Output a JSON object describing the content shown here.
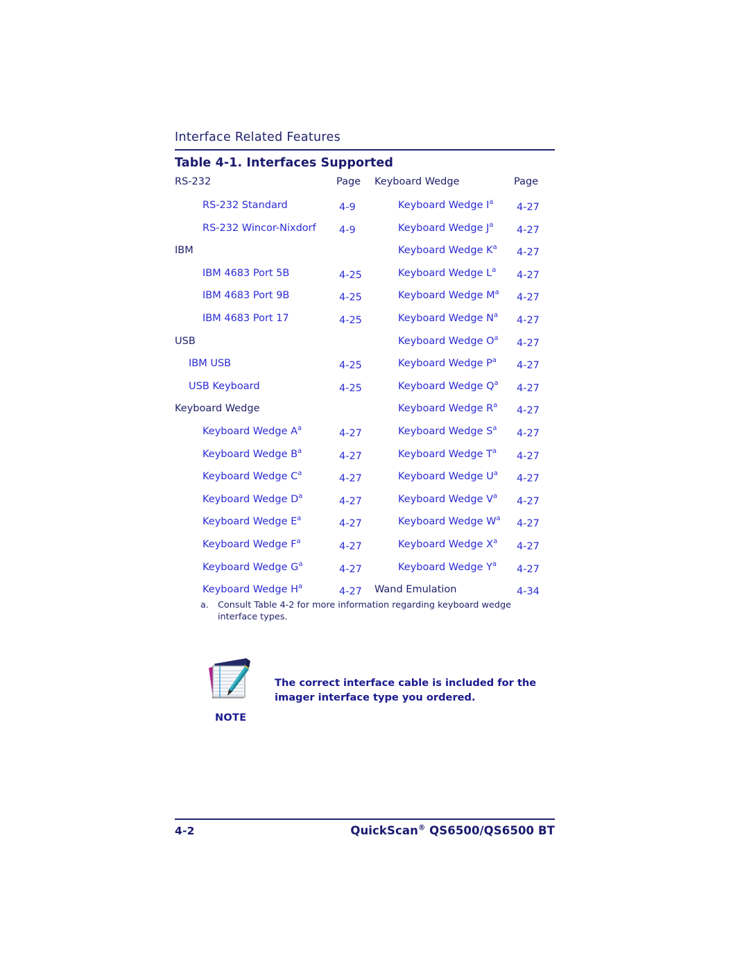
{
  "header": {
    "running_head": "Interface Related Features",
    "table_caption": "Table 4-1. Interfaces Supported"
  },
  "colors": {
    "navy": "#20206b",
    "link_blue": "#2b2bd6",
    "note_blue": "#1a1a8e",
    "page_background": "#ffffff"
  },
  "table": {
    "left_column_header": "RS-232",
    "left_page_header": "Page",
    "right_column_header": "Keyboard Wedge",
    "right_page_header": "Page",
    "left_rows": [
      {
        "label": "RS-232 Standard",
        "page": "4-9",
        "kind": "link",
        "indent": 2,
        "footnote": false
      },
      {
        "label": "RS-232 Wincor-Nixdorf",
        "page": "4-9",
        "kind": "link",
        "indent": 2,
        "footnote": false
      },
      {
        "label": "IBM",
        "page": "",
        "kind": "group",
        "indent": 0,
        "footnote": false
      },
      {
        "label": "IBM 4683 Port 5B",
        "page": "4-25",
        "kind": "link",
        "indent": 2,
        "footnote": false
      },
      {
        "label": "IBM 4683 Port 9B",
        "page": "4-25",
        "kind": "link",
        "indent": 2,
        "footnote": false
      },
      {
        "label": "IBM 4683 Port 17",
        "page": "4-25",
        "kind": "link",
        "indent": 2,
        "footnote": false
      },
      {
        "label": "USB",
        "page": "",
        "kind": "group",
        "indent": 0,
        "footnote": false
      },
      {
        "label": "IBM USB",
        "page": "4-25",
        "kind": "link",
        "indent": 1,
        "footnote": false
      },
      {
        "label": "USB Keyboard",
        "page": "4-25",
        "kind": "link",
        "indent": 1,
        "footnote": false
      },
      {
        "label": "Keyboard Wedge",
        "page": "",
        "kind": "group",
        "indent": 0,
        "footnote": false
      },
      {
        "label": "Keyboard Wedge A",
        "page": "4-27",
        "kind": "link",
        "indent": 2,
        "footnote": true
      },
      {
        "label": "Keyboard Wedge B",
        "page": "4-27",
        "kind": "link",
        "indent": 2,
        "footnote": true
      },
      {
        "label": "Keyboard Wedge C",
        "page": "4-27",
        "kind": "link",
        "indent": 2,
        "footnote": true
      },
      {
        "label": "Keyboard Wedge D",
        "page": "4-27",
        "kind": "link",
        "indent": 2,
        "footnote": true
      },
      {
        "label": "Keyboard Wedge E",
        "page": "4-27",
        "kind": "link",
        "indent": 2,
        "footnote": true
      },
      {
        "label": "Keyboard Wedge F",
        "page": "4-27",
        "kind": "link",
        "indent": 2,
        "footnote": true
      },
      {
        "label": "Keyboard Wedge G",
        "page": "4-27",
        "kind": "link",
        "indent": 2,
        "footnote": true
      },
      {
        "label": "Keyboard Wedge H",
        "page": "4-27",
        "kind": "link",
        "indent": 2,
        "footnote": true
      }
    ],
    "right_rows": [
      {
        "label": "Keyboard Wedge I",
        "page": "4-27",
        "kind": "link",
        "indent": 1,
        "footnote": true
      },
      {
        "label": "Keyboard Wedge J",
        "page": "4-27",
        "kind": "link",
        "indent": 1,
        "footnote": true
      },
      {
        "label": "Keyboard Wedge K",
        "page": "4-27",
        "kind": "link",
        "indent": 1,
        "footnote": true
      },
      {
        "label": "Keyboard Wedge L",
        "page": "4-27",
        "kind": "link",
        "indent": 1,
        "footnote": true
      },
      {
        "label": "Keyboard Wedge M",
        "page": "4-27",
        "kind": "link",
        "indent": 1,
        "footnote": true
      },
      {
        "label": "Keyboard Wedge N",
        "page": "4-27",
        "kind": "link",
        "indent": 1,
        "footnote": true
      },
      {
        "label": "Keyboard Wedge O",
        "page": "4-27",
        "kind": "link",
        "indent": 1,
        "footnote": true
      },
      {
        "label": "Keyboard Wedge P",
        "page": "4-27",
        "kind": "link",
        "indent": 1,
        "footnote": true
      },
      {
        "label": "Keyboard Wedge Q",
        "page": "4-27",
        "kind": "link",
        "indent": 1,
        "footnote": true
      },
      {
        "label": "Keyboard Wedge R",
        "page": "4-27",
        "kind": "link",
        "indent": 1,
        "footnote": true
      },
      {
        "label": "Keyboard Wedge S",
        "page": "4-27",
        "kind": "link",
        "indent": 1,
        "footnote": true
      },
      {
        "label": "Keyboard Wedge T",
        "page": "4-27",
        "kind": "link",
        "indent": 1,
        "footnote": true
      },
      {
        "label": "Keyboard Wedge U",
        "page": "4-27",
        "kind": "link",
        "indent": 1,
        "footnote": true
      },
      {
        "label": "Keyboard Wedge V",
        "page": "4-27",
        "kind": "link",
        "indent": 1,
        "footnote": true
      },
      {
        "label": "Keyboard Wedge W",
        "page": "4-27",
        "kind": "link",
        "indent": 1,
        "footnote": true
      },
      {
        "label": "Keyboard Wedge X",
        "page": "4-27",
        "kind": "link",
        "indent": 1,
        "footnote": true
      },
      {
        "label": "Keyboard Wedge Y",
        "page": "4-27",
        "kind": "link",
        "indent": 1,
        "footnote": true
      },
      {
        "label": "Wand Emulation",
        "page": "4-34",
        "kind": "group",
        "indent": 0,
        "footnote": false
      }
    ]
  },
  "footnote": {
    "marker": "a.",
    "text": "Consult Table 4-2 for more information regarding keyboard wedge interface types."
  },
  "note": {
    "label": "NOTE",
    "icon": "notepad-pen-icon",
    "text": "The correct interface cable is included for the imager interface type you ordered."
  },
  "footer": {
    "page_number": "4-2",
    "product_name": "QuickScan",
    "registered_mark": "®",
    "product_models": " QS6500/QS6500 BT"
  }
}
